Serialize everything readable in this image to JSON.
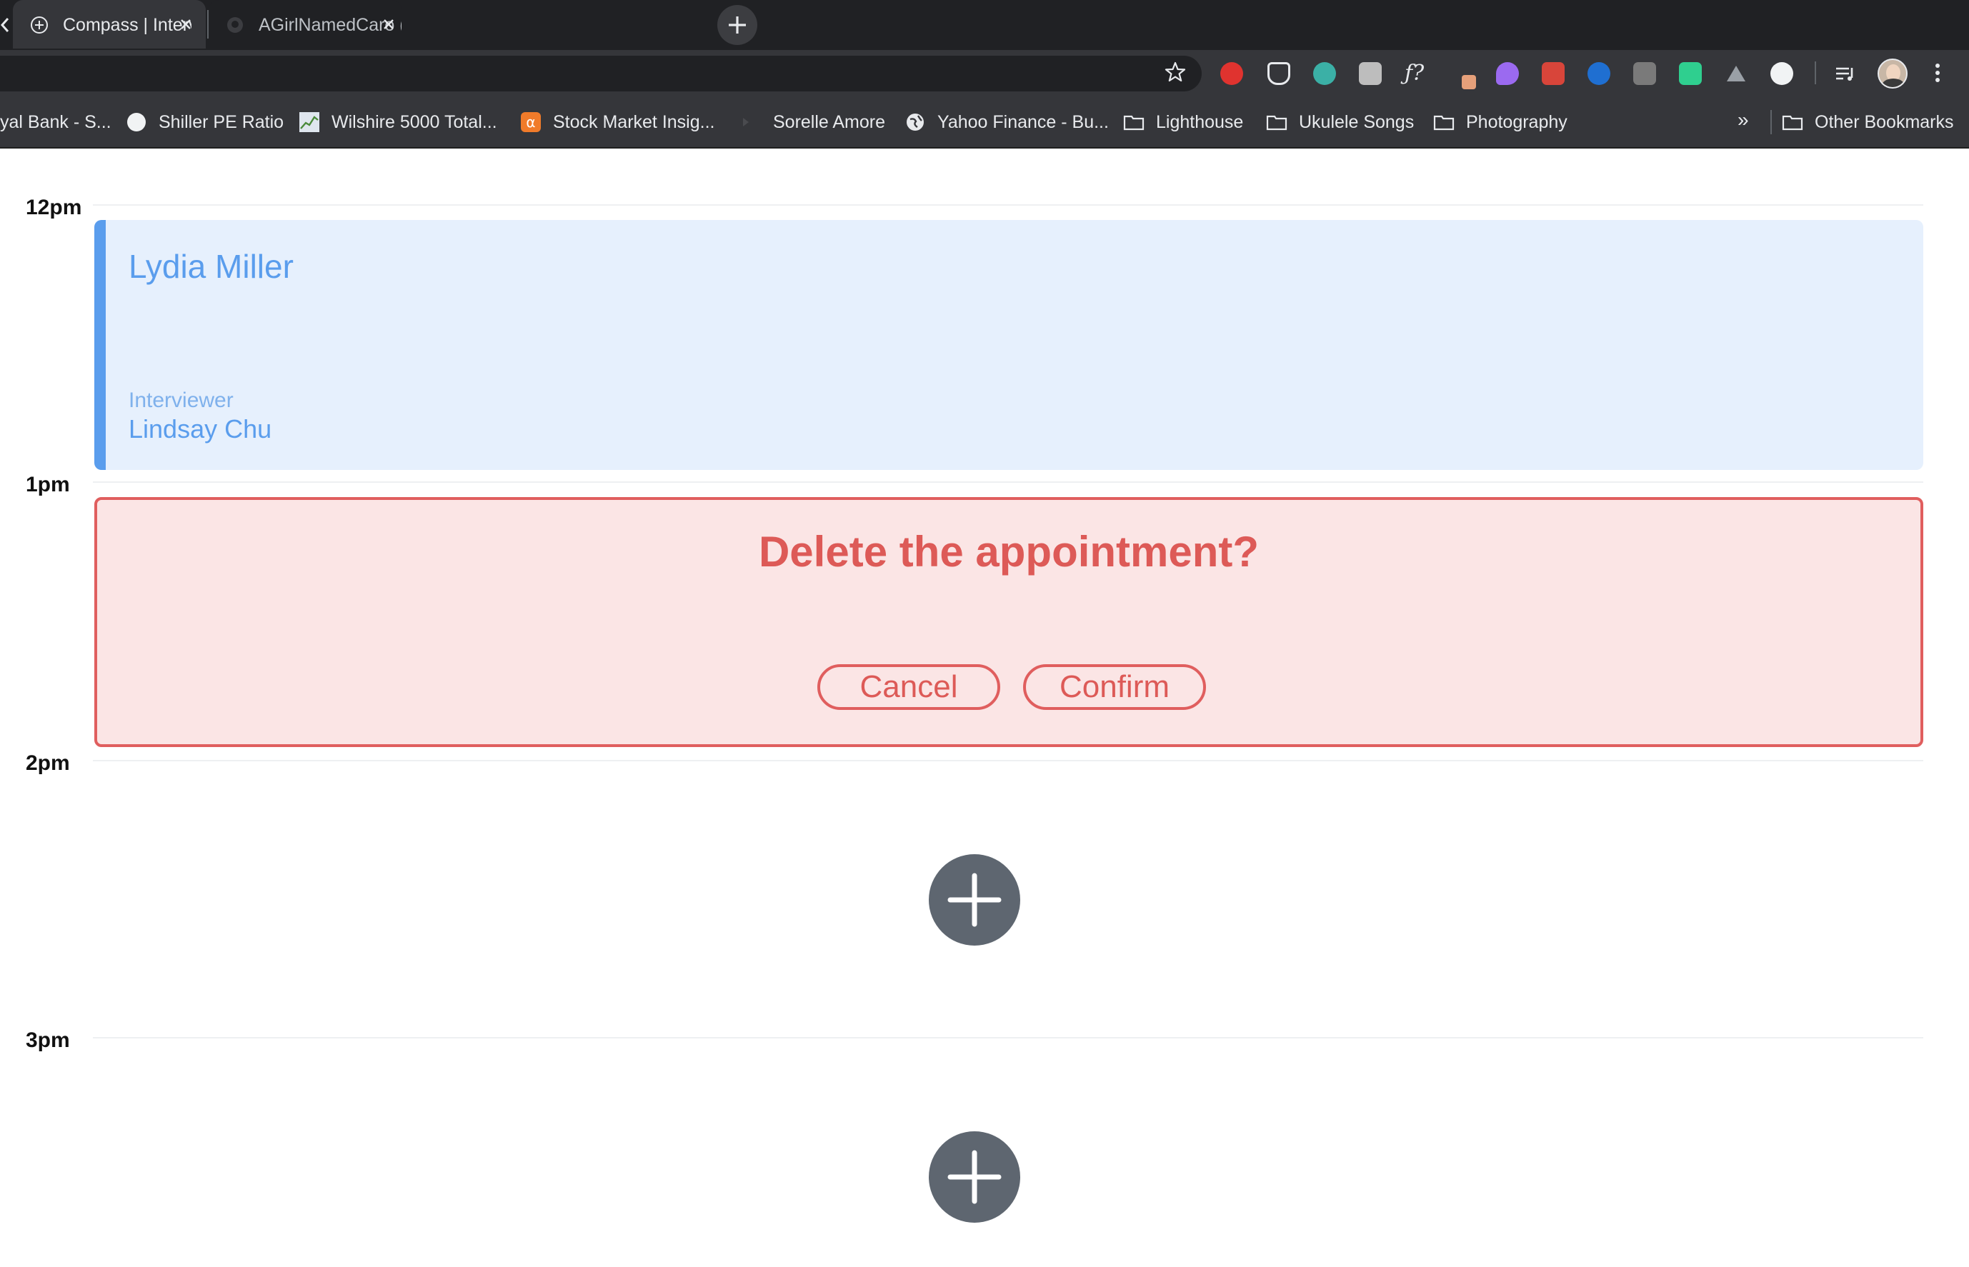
{
  "browser": {
    "tabs": [
      {
        "title": "Compass | Interview Scheduler",
        "active": true
      },
      {
        "title": "AGirlNamedCaro (Carolina Contr",
        "active": false
      }
    ],
    "extensions": [
      "adblock-icon",
      "pocket-icon",
      "mint-icon",
      "keyword-icon",
      "formula-icon",
      "pen-tool-icon",
      "color-icon",
      "bug-icon",
      "health-icon",
      "photo-icon",
      "notion-icon",
      "drive-icon",
      "code-icon",
      "reading-list-icon"
    ],
    "bookmarks": [
      {
        "label": "yal Bank - S...",
        "icon": "bank-icon"
      },
      {
        "label": "Shiller PE Ratio",
        "icon": "circle-icon"
      },
      {
        "label": "Wilshire 5000 Total...",
        "icon": "chart-icon"
      },
      {
        "label": "Stock Market Insig...",
        "icon": "alpha-icon"
      },
      {
        "label": "Sorelle Amore",
        "icon": "video-icon"
      },
      {
        "label": "Yahoo Finance - Bu...",
        "icon": "globe-icon"
      },
      {
        "label": "Lighthouse",
        "icon": "folder-icon"
      },
      {
        "label": "Ukulele Songs",
        "icon": "folder-icon"
      },
      {
        "label": "Photography",
        "icon": "folder-icon"
      }
    ],
    "overflow_label": "»",
    "other_bookmarks": "Other Bookmarks"
  },
  "schedule": {
    "times": [
      "12pm",
      "1pm",
      "2pm",
      "3pm"
    ],
    "appointment": {
      "student": "Lydia Miller",
      "interviewer_label": "Interviewer",
      "interviewer": "Lindsay Chu"
    },
    "confirm": {
      "message": "Delete the appointment?",
      "cancel_label": "Cancel",
      "confirm_label": "Confirm"
    }
  },
  "colors": {
    "appointment_accent": "#5a9ded",
    "appointment_bg": "#e6f0fd",
    "danger": "#dd5a57",
    "danger_bg": "#fbe5e5",
    "add_button": "#5e6670"
  }
}
